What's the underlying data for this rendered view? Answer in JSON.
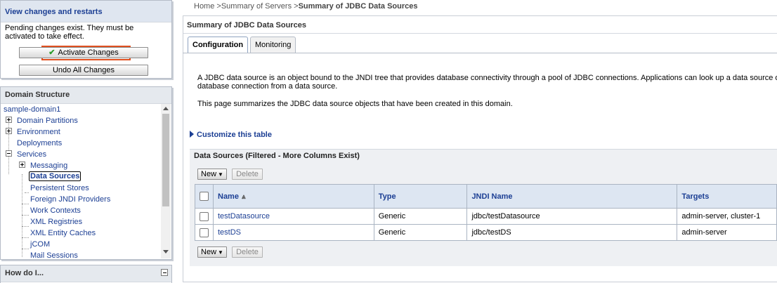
{
  "change_center": {
    "title": "View changes and restarts",
    "message": "Pending changes exist. They must be activated to take effect.",
    "activate_label": "Activate Changes",
    "undo_label": "Undo All Changes"
  },
  "domain_structure": {
    "title": "Domain Structure",
    "root": "sample-domain1",
    "items": [
      {
        "label": "Domain Partitions"
      },
      {
        "label": "Environment"
      },
      {
        "label": "Deployments"
      },
      {
        "label": "Services"
      },
      {
        "label": "Messaging"
      },
      {
        "label": "Data Sources"
      },
      {
        "label": "Persistent Stores"
      },
      {
        "label": "Foreign JNDI Providers"
      },
      {
        "label": "Work Contexts"
      },
      {
        "label": "XML Registries"
      },
      {
        "label": "XML Entity Caches"
      },
      {
        "label": "jCOM"
      },
      {
        "label": "Mail Sessions"
      }
    ]
  },
  "how_do_i": {
    "title": "How do I..."
  },
  "breadcrumb": {
    "home": "Home",
    "sep1": " >",
    "servers": "Summary of Servers",
    "sep2": " >",
    "current": "Summary of JDBC Data Sources"
  },
  "main": {
    "title": "Summary of JDBC Data Sources",
    "tabs": [
      {
        "label": "Configuration"
      },
      {
        "label": "Monitoring"
      }
    ],
    "description_line1": "A JDBC data source is an object bound to the JNDI tree that provides database connectivity through a pool of JDBC connections. Applications can look up a data source o",
    "description_line2": "database connection from a data source.",
    "description_line3": "This page summarizes the JDBC data source objects that have been created in this domain.",
    "customize_label": "Customize this table",
    "table_title": "Data Sources (Filtered - More Columns Exist)",
    "new_label": "New",
    "delete_label": "Delete",
    "columns": [
      "Name",
      "Type",
      "JNDI Name",
      "Targets"
    ],
    "rows": [
      {
        "name": "testDatasource",
        "type": "Generic",
        "jndi": "jdbc/testDatasource",
        "targets": "admin-server, cluster-1"
      },
      {
        "name": "testDS",
        "type": "Generic",
        "jndi": "jdbc/testDS",
        "targets": "admin-server"
      }
    ]
  },
  "colors": {
    "link": "#1c3f94",
    "highlight_border": "#e05020",
    "check_icon": "#2e9d2e"
  }
}
